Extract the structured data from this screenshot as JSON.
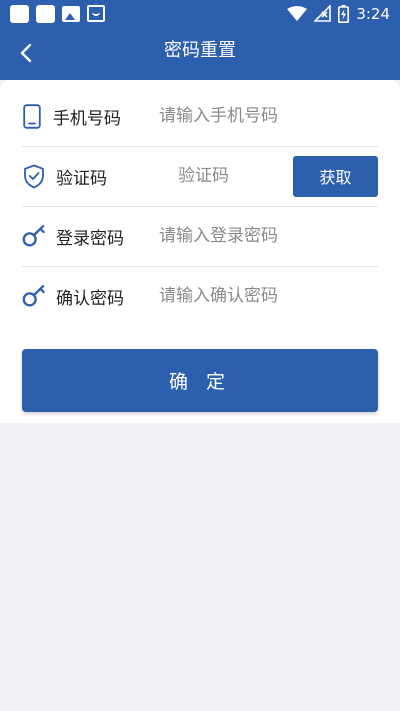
{
  "status_bar": {
    "time": "3:24",
    "icons": [
      "notification-icon",
      "notification-icon",
      "image-notification-icon",
      "shopping-bag-notification-icon",
      "wifi-icon",
      "no-signal-icon",
      "battery-charging-icon"
    ]
  },
  "header": {
    "title": "密码重置",
    "back_icon": "chevron-left-icon",
    "background": "#2c5fae"
  },
  "form": {
    "phone": {
      "label": "手机号码",
      "placeholder": "请输入手机号码",
      "icon": "phone-icon"
    },
    "code": {
      "label": "验证码",
      "placeholder": "验证码",
      "icon": "shield-check-icon",
      "button_label": "获取"
    },
    "password": {
      "label": "登录密码",
      "placeholder": "请输入登录密码",
      "icon": "key-icon"
    },
    "confirm_password": {
      "label": "确认密码",
      "placeholder": "请输入确认密码",
      "icon": "key-icon"
    }
  },
  "actions": {
    "confirm_label": "确 定"
  },
  "colors": {
    "accent": "#2c5fae",
    "page_background": "#f1f1f5",
    "card_background": "#ffffff"
  }
}
